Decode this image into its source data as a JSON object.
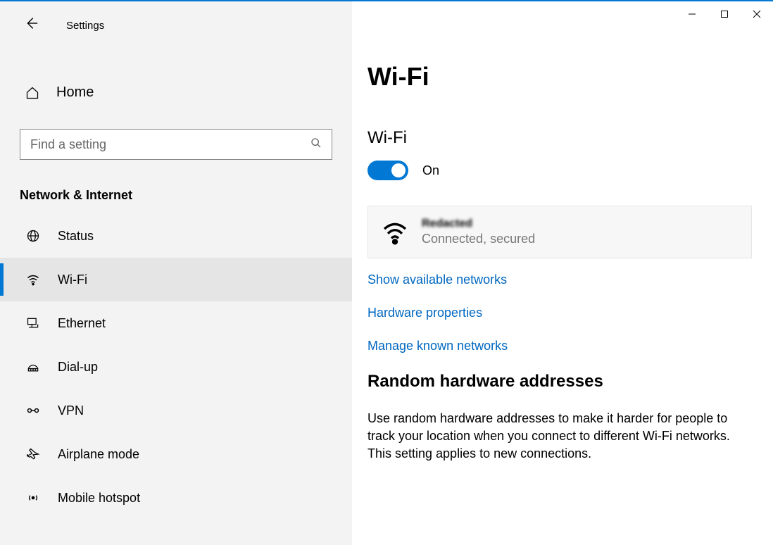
{
  "app": {
    "title": "Settings"
  },
  "home": {
    "label": "Home"
  },
  "search": {
    "placeholder": "Find a setting"
  },
  "sectionHeader": "Network & Internet",
  "navItems": {
    "status": "Status",
    "wifi": "Wi-Fi",
    "ethernet": "Ethernet",
    "dialup": "Dial-up",
    "vpn": "VPN",
    "airplane": "Airplane mode",
    "hotspot": "Mobile hotspot"
  },
  "main": {
    "title": "Wi-Fi",
    "subheader": "Wi-Fi",
    "toggle": {
      "state": "On"
    },
    "network": {
      "name": "Redacted",
      "status": "Connected, secured"
    },
    "links": {
      "available": "Show available networks",
      "hardware": "Hardware properties",
      "manage": "Manage known networks"
    },
    "randomHeading": "Random hardware addresses",
    "randomBody": "Use random hardware addresses to make it harder for people to track your location when you connect to different Wi-Fi networks. This setting applies to new connections."
  }
}
